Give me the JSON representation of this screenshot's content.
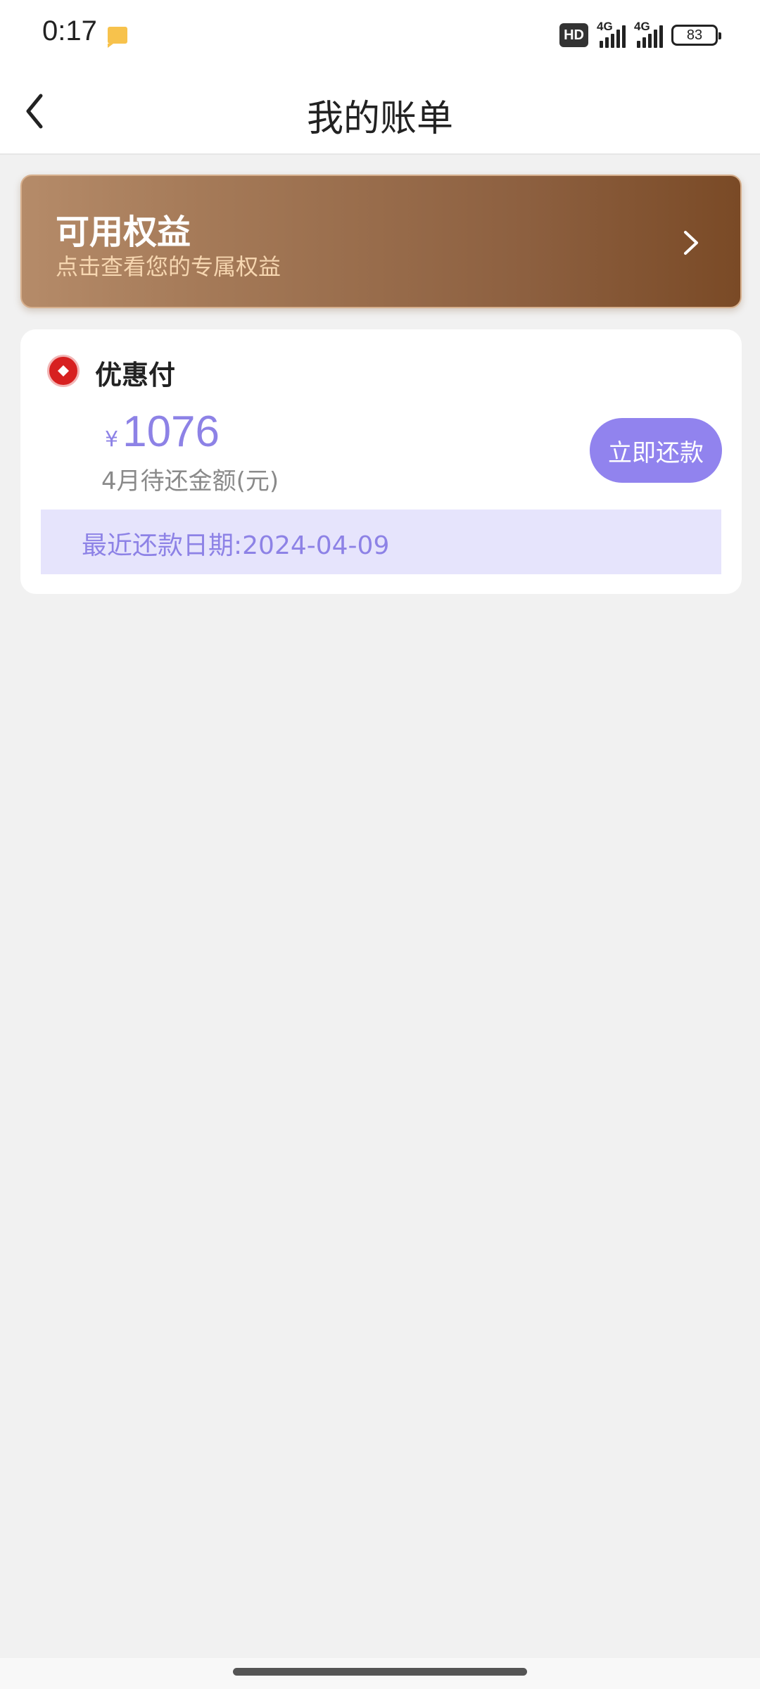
{
  "status_bar": {
    "time": "0:17",
    "hd_label": "HD",
    "sim1_network": "4G",
    "sim2_network": "4G",
    "battery_level": "83"
  },
  "header": {
    "title": "我的账单",
    "back_icon": "chevron-left-icon"
  },
  "benefits": {
    "title": "可用权益",
    "subtitle": "点击查看您的专属权益",
    "arrow_icon": "chevron-right-icon"
  },
  "bill": {
    "product_name": "优惠付",
    "currency": "¥",
    "amount": "1076",
    "amount_label": "4月待还金额(元)",
    "repay_label": "立即还款",
    "due_label": "最近还款日期:",
    "due_date": "2024-04-09"
  },
  "colors": {
    "accent": "#9183ee",
    "amount": "#8d82e6",
    "due_bg": "#e6e4fc",
    "banner_start": "#b58b69",
    "banner_end": "#7a4a26",
    "page_bg": "#f1f1f1"
  }
}
